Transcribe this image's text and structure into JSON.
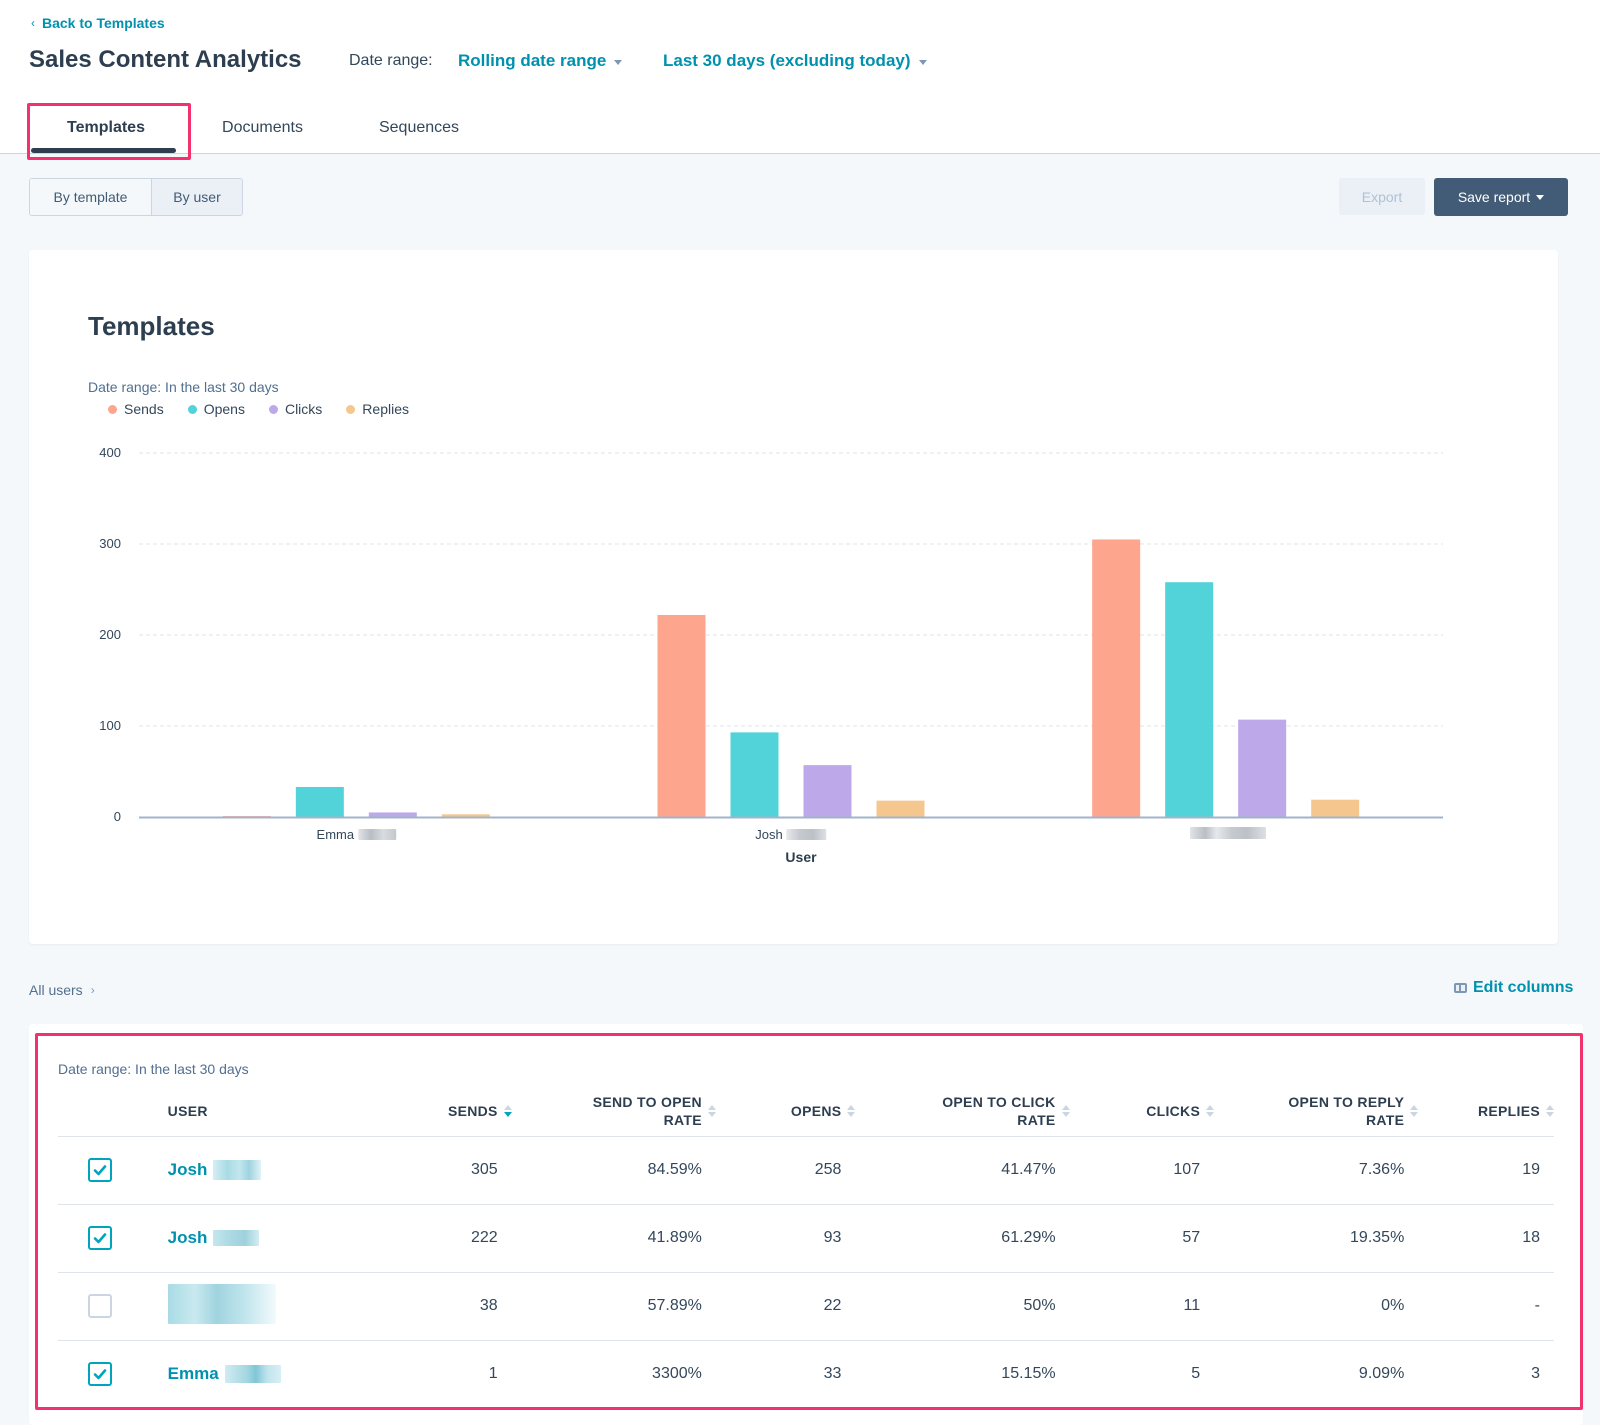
{
  "header": {
    "back_link": "Back to Templates",
    "title": "Sales Content Analytics",
    "date_range_label": "Date range:",
    "date_range_type": "Rolling date range",
    "date_range_value": "Last 30 days (excluding today)"
  },
  "tabs": [
    {
      "label": "Templates",
      "active": true
    },
    {
      "label": "Documents",
      "active": false
    },
    {
      "label": "Sequences",
      "active": false
    }
  ],
  "view_toggle": {
    "options": [
      "By template",
      "By user"
    ],
    "selected": "By user"
  },
  "actions": {
    "export_label": "Export",
    "export_disabled": true,
    "save_label": "Save report"
  },
  "chart_card": {
    "title": "Templates",
    "date_range": "Date range: In the last 30 days"
  },
  "chart_data": {
    "type": "bar",
    "title": "Templates",
    "subtitle": "Date range: In the last 30 days",
    "xlabel": "User",
    "ylabel": "",
    "categories": [
      "Emma [redacted]",
      "Josh [redacted]",
      "[redacted]"
    ],
    "category_visible_text": [
      "Emma",
      "Josh",
      ""
    ],
    "series": [
      {
        "name": "Sends",
        "color": "#fea58e",
        "values": [
          1,
          222,
          305
        ]
      },
      {
        "name": "Opens",
        "color": "#51d3d9",
        "values": [
          33,
          93,
          258
        ]
      },
      {
        "name": "Clicks",
        "color": "#bda9ea",
        "values": [
          5,
          57,
          107
        ]
      },
      {
        "name": "Replies",
        "color": "#f5c78e",
        "values": [
          3,
          18,
          19
        ]
      }
    ],
    "yticks": [
      0,
      100,
      200,
      300,
      400
    ],
    "ylim": [
      0,
      400
    ],
    "grid": true,
    "legend_position": "top-left"
  },
  "breadcrumb": {
    "label": "All users"
  },
  "edit_columns_label": "Edit columns",
  "table": {
    "date_range": "Date range: In the last 30 days",
    "columns": [
      {
        "key": "user",
        "label": "USER",
        "sortable": false
      },
      {
        "key": "sends",
        "label": "SENDS",
        "sortable": true,
        "sorted": "desc"
      },
      {
        "key": "send_to_open_rate",
        "label": "SEND TO OPEN RATE",
        "line1": "SEND TO OPEN",
        "line2": "RATE",
        "sortable": true
      },
      {
        "key": "opens",
        "label": "OPENS",
        "sortable": true
      },
      {
        "key": "open_to_click_rate",
        "label": "OPEN TO CLICK RATE",
        "line1": "OPEN TO CLICK",
        "line2": "RATE",
        "sortable": true
      },
      {
        "key": "clicks",
        "label": "CLICKS",
        "sortable": true
      },
      {
        "key": "open_to_reply_rate",
        "label": "OPEN TO REPLY RATE",
        "line1": "OPEN TO REPLY",
        "line2": "RATE",
        "sortable": true
      },
      {
        "key": "replies",
        "label": "REPLIES",
        "sortable": true
      }
    ],
    "rows": [
      {
        "checked": true,
        "user": "Josh",
        "sends": "305",
        "send_to_open_rate": "84.59%",
        "opens": "258",
        "open_to_click_rate": "41.47%",
        "clicks": "107",
        "open_to_reply_rate": "7.36%",
        "replies": "19"
      },
      {
        "checked": true,
        "user": "Josh",
        "sends": "222",
        "send_to_open_rate": "41.89%",
        "opens": "93",
        "open_to_click_rate": "61.29%",
        "clicks": "57",
        "open_to_reply_rate": "19.35%",
        "replies": "18"
      },
      {
        "checked": false,
        "user": "",
        "sends": "38",
        "send_to_open_rate": "57.89%",
        "opens": "22",
        "open_to_click_rate": "50%",
        "clicks": "11",
        "open_to_reply_rate": "0%",
        "replies": "-"
      },
      {
        "checked": true,
        "user": "Emma",
        "sends": "1",
        "send_to_open_rate": "3300%",
        "opens": "33",
        "open_to_click_rate": "15.15%",
        "clicks": "5",
        "open_to_reply_rate": "9.09%",
        "replies": "3"
      }
    ]
  },
  "colors": {
    "accent": "#0091ae",
    "highlight": "#f2316e",
    "primary_button": "#425b76",
    "text_dark": "#2d3e50"
  }
}
